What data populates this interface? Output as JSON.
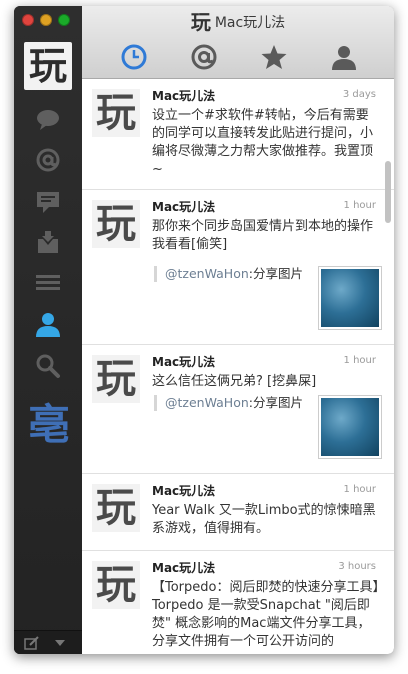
{
  "app": {
    "title": "Mac玩儿法",
    "logo_char": "玩",
    "brand_char": "亳"
  },
  "tabs": [
    {
      "name": "timeline",
      "icon": "clock-icon",
      "active": true
    },
    {
      "name": "mentions",
      "icon": "at-icon",
      "active": false
    },
    {
      "name": "favorites",
      "icon": "star-icon",
      "active": false
    },
    {
      "name": "profile",
      "icon": "person-icon",
      "active": false
    }
  ],
  "sidebar": {
    "items": [
      {
        "icon": "chat-bubble-icon"
      },
      {
        "icon": "at-icon"
      },
      {
        "icon": "messages-icon"
      },
      {
        "icon": "inbox-icon"
      },
      {
        "icon": "lists-icon"
      },
      {
        "icon": "profile-icon",
        "active": true
      },
      {
        "icon": "search-icon"
      }
    ]
  },
  "tweets": [
    {
      "name": "Mac玩儿法",
      "time": "3 days",
      "text": "设立一个#求软件#转帖，今后有需要的同学可以直接转发此贴进行提问，小编将尽微薄之力帮大家做推荐。我置顶~"
    },
    {
      "name": "Mac玩儿法",
      "time": "1 hour",
      "text": "那你来个同步岛国爱情片到本地的操作我看看[偷笑]",
      "quote_user": "@tzenWaHon",
      "quote_text": ":分享图片"
    },
    {
      "name": "Mac玩儿法",
      "time": "1 hour",
      "text": "这么信任这俩兄弟? [挖鼻屎]",
      "quote_user": "@tzenWaHon",
      "quote_text": ":分享图片"
    },
    {
      "name": "Mac玩儿法",
      "time": "1 hour",
      "text": "Year Walk 又一款Limbo式的惊悚暗黑系游戏，值得拥有。"
    },
    {
      "name": "Mac玩儿法",
      "time": "3 hours",
      "text": "【Torpedo：阅后即焚的快速分享工具】Torpedo 是一款受Snapchat \"阅后即焚\" 概念影响的Mac端文件分享工具，分享文件拥有一个可公开访问的"
    }
  ],
  "colors": {
    "accent": "#2f7ad6",
    "sidebar_bg": "#2a2a2a",
    "link": "#6d7f93"
  }
}
